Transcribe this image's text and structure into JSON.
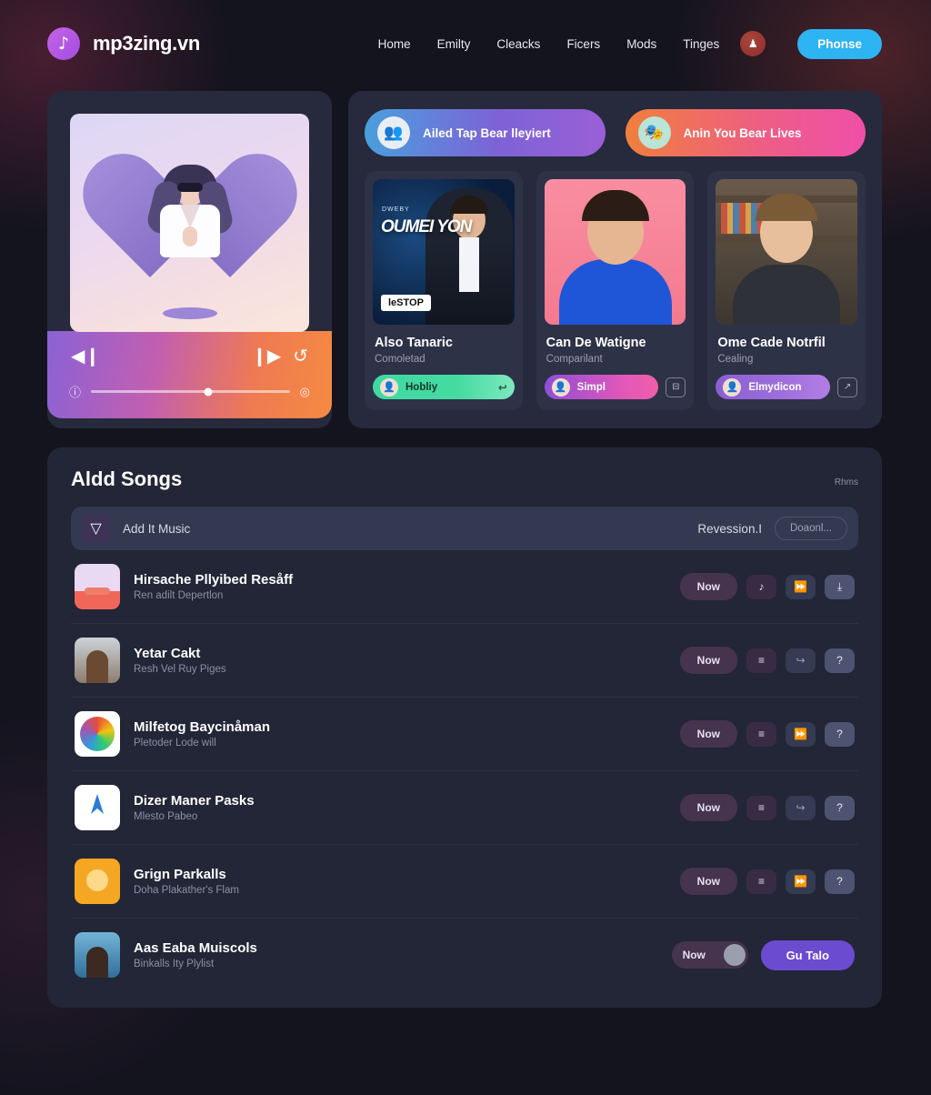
{
  "brand": {
    "logo_icon": "music-note-icon",
    "logo_glyph": "♪",
    "name": "mp3zing.vn"
  },
  "nav": {
    "items": [
      {
        "label": "Home"
      },
      {
        "label": "Emilty"
      },
      {
        "label": "Cleacks"
      },
      {
        "label": "Ficers"
      },
      {
        "label": "Mods"
      },
      {
        "label": "Tinges"
      }
    ],
    "avatar_icon": "user-avatar-icon",
    "avatar_glyph": "♟",
    "cta_label": "Phonse",
    "cta_color": "#2eb3f3"
  },
  "player": {
    "art_alt": "heart-illustration-album-art",
    "controls": {
      "prev_icon": "previous-track-icon",
      "prev_glyph": "◀❙",
      "next_icon": "next-track-icon",
      "next_glyph": "❙▶",
      "repeat_icon": "repeat-icon",
      "repeat_glyph": "↺",
      "info_icon": "info-icon",
      "info_glyph": "ⓘ",
      "volume_icon": "volume-icon",
      "volume_glyph": "◎",
      "progress_percent": 59
    }
  },
  "banners": [
    {
      "label": "Ailed Tap Bear lleyiert",
      "avatar_icon": "people-avatar-icon",
      "avatar_glyph": "👥",
      "gradient": "#4a9fdc → #9a5fd6"
    },
    {
      "label": "Anin You Bear Lives",
      "avatar_icon": "group-avatar-icon",
      "avatar_glyph": "🎭",
      "gradient": "#f07f3c → #ef4fa8"
    }
  ],
  "media_cards": [
    {
      "art_kicker": "DWEBY",
      "art_title": "OUMEI YON",
      "art_badge": "leSTOP",
      "title": "Also Tanaric",
      "subtitle": "Comoletad",
      "tag_label": "Hobliy",
      "tag_style": "green",
      "tag_avatar_icon": "person-avatar-icon",
      "tag_avatar_glyph": "👤",
      "trailing_icon": "waveform-icon",
      "trailing_glyph": "↩",
      "action_icon": "bookmark-icon",
      "action_glyph": "⊟"
    },
    {
      "art_kicker": "",
      "art_title": "",
      "art_badge": "",
      "title": "Can De Watigne",
      "subtitle": "Comparilant",
      "tag_label": "Simpl",
      "tag_style": "pink",
      "tag_avatar_icon": "person-avatar-icon",
      "tag_avatar_glyph": "👤",
      "trailing_icon": "",
      "trailing_glyph": "",
      "action_icon": "minus-box-icon",
      "action_glyph": "⊟"
    },
    {
      "art_kicker": "",
      "art_title": "",
      "art_badge": "",
      "title": "Ome Cade Notrfil",
      "subtitle": "Cealing",
      "tag_label": "Elmydicon",
      "tag_style": "purple",
      "tag_avatar_icon": "person-avatar-icon",
      "tag_avatar_glyph": "👤",
      "trailing_icon": "",
      "trailing_glyph": "",
      "action_icon": "edit-box-icon",
      "action_glyph": "↗"
    }
  ],
  "songs": {
    "title": "Aldd Songs",
    "corner_label": "Rhms",
    "search": {
      "filter_icon": "filter-funnel-icon",
      "filter_glyph": "▽",
      "value": "Add It Music",
      "placeholder": "Add It Music",
      "right_label": "Revession.I",
      "right_button": "Doaonl..."
    },
    "rows": [
      {
        "thumb": "t1",
        "title": "Hirsache Pllyibed Resåff",
        "subtitle": "Ren adilt Depertlon",
        "now_label": "Now",
        "actions": [
          {
            "icon": "music-note-icon",
            "glyph": "♪",
            "style": "dark"
          },
          {
            "icon": "fast-forward-icon",
            "glyph": "⏩",
            "style": "mid"
          },
          {
            "icon": "download-icon",
            "glyph": "⤓",
            "style": "light"
          }
        ]
      },
      {
        "thumb": "t2",
        "title": "Yetar Cakt",
        "subtitle": "Resh Vel Ruy Piges",
        "now_label": "Now",
        "actions": [
          {
            "icon": "equalizer-icon",
            "glyph": "≡",
            "style": "dark"
          },
          {
            "icon": "share-icon",
            "glyph": "↪",
            "style": "mid"
          },
          {
            "icon": "help-icon",
            "glyph": "?",
            "style": "light"
          }
        ]
      },
      {
        "thumb": "t3",
        "title": "Milfetog Baycinåman",
        "subtitle": "Pletoder Lode will",
        "now_label": "Now",
        "actions": [
          {
            "icon": "equalizer-icon",
            "glyph": "≡",
            "style": "dark"
          },
          {
            "icon": "fast-forward-icon",
            "glyph": "⏩",
            "style": "mid"
          },
          {
            "icon": "help-icon",
            "glyph": "?",
            "style": "light"
          }
        ]
      },
      {
        "thumb": "t4",
        "title": "Dizer Maner Pasks",
        "subtitle": "Mlesto Pabeo",
        "now_label": "Now",
        "actions": [
          {
            "icon": "equalizer-icon",
            "glyph": "≡",
            "style": "dark"
          },
          {
            "icon": "share-icon",
            "glyph": "↪",
            "style": "mid"
          },
          {
            "icon": "help-icon",
            "glyph": "?",
            "style": "light"
          }
        ]
      },
      {
        "thumb": "t5",
        "title": "Grign Parkalls",
        "subtitle": "Doha Plakather's Flam",
        "now_label": "Now",
        "actions": [
          {
            "icon": "equalizer-icon",
            "glyph": "≡",
            "style": "dark"
          },
          {
            "icon": "fast-forward-icon",
            "glyph": "⏩",
            "style": "mid"
          },
          {
            "icon": "help-icon",
            "glyph": "?",
            "style": "light"
          }
        ]
      }
    ],
    "last_row": {
      "thumb": "t6",
      "title": "Aas Eaba Muiscols",
      "subtitle": "Binkalls Ity Plylist",
      "toggle_label": "Now",
      "cta_label": "Gu Talo",
      "cta_color": "#6b4bd0"
    }
  }
}
